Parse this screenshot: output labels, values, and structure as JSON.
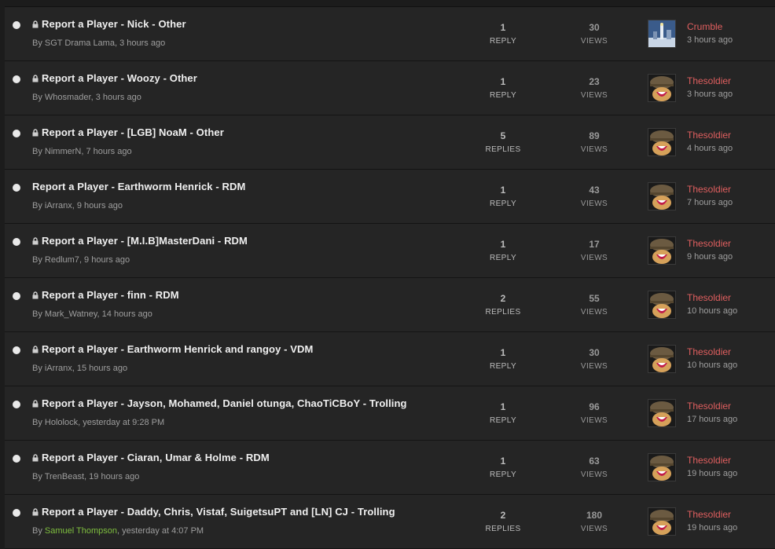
{
  "topics": [
    {
      "title": "Report a Player - Nick - Other",
      "locked": true,
      "by_prefix": "By ",
      "author": "SGT Drama Lama",
      "started": ", 3 hours ago",
      "replies": "1",
      "replies_label": "REPLY",
      "views": "30",
      "views_label": "VIEWS",
      "last_user": "Crumble",
      "last_time": "3 hours ago",
      "avatar": "city-avatar-icon"
    },
    {
      "title": "Report a Player - Woozy - Other",
      "locked": true,
      "by_prefix": "By ",
      "author": "Whosmader",
      "started": ", 3 hours ago",
      "replies": "1",
      "replies_label": "REPLY",
      "views": "23",
      "views_label": "VIEWS",
      "last_user": "Thesoldier",
      "last_time": "3 hours ago",
      "avatar": "soldier-avatar-icon"
    },
    {
      "title": "Report a Player - [LGB] NoaM - Other",
      "locked": true,
      "by_prefix": "By ",
      "author": "NimmerN",
      "started": ", 7 hours ago",
      "replies": "5",
      "replies_label": "REPLIES",
      "views": "89",
      "views_label": "VIEWS",
      "last_user": "Thesoldier",
      "last_time": "4 hours ago",
      "avatar": "soldier-avatar-icon"
    },
    {
      "title": "Report a Player - Earthworm Henrick - RDM",
      "locked": false,
      "by_prefix": "By ",
      "author": "iArranx",
      "started": ", 9 hours ago",
      "replies": "1",
      "replies_label": "REPLY",
      "views": "43",
      "views_label": "VIEWS",
      "last_user": "Thesoldier",
      "last_time": "7 hours ago",
      "avatar": "soldier-avatar-icon"
    },
    {
      "title": "Report a Player - [M.I.B]MasterDani - RDM",
      "locked": true,
      "by_prefix": "By ",
      "author": "Redlum7",
      "started": ", 9 hours ago",
      "replies": "1",
      "replies_label": "REPLY",
      "views": "17",
      "views_label": "VIEWS",
      "last_user": "Thesoldier",
      "last_time": "9 hours ago",
      "avatar": "soldier-avatar-icon"
    },
    {
      "title": "Report a Player - finn - RDM",
      "locked": true,
      "by_prefix": "By ",
      "author": "Mark_Watney",
      "started": ", 14 hours ago",
      "replies": "2",
      "replies_label": "REPLIES",
      "views": "55",
      "views_label": "VIEWS",
      "last_user": "Thesoldier",
      "last_time": "10 hours ago",
      "avatar": "soldier-avatar-icon"
    },
    {
      "title": "Report a Player - Earthworm Henrick and rangoy - VDM",
      "locked": true,
      "by_prefix": "By ",
      "author": "iArranx",
      "started": ", 15 hours ago",
      "replies": "1",
      "replies_label": "REPLY",
      "views": "30",
      "views_label": "VIEWS",
      "last_user": "Thesoldier",
      "last_time": "10 hours ago",
      "avatar": "soldier-avatar-icon"
    },
    {
      "title": "Report a Player - Jayson, Mohamed, Daniel otunga, ChaoTiCBoY - Trolling",
      "locked": true,
      "by_prefix": "By ",
      "author": "Hololock",
      "started": ", yesterday at 9:28 PM",
      "replies": "1",
      "replies_label": "REPLY",
      "views": "96",
      "views_label": "VIEWS",
      "last_user": "Thesoldier",
      "last_time": "17 hours ago",
      "avatar": "soldier-avatar-icon"
    },
    {
      "title": "Report a Player - Ciaran, Umar & Holme - RDM",
      "locked": true,
      "by_prefix": "By ",
      "author": "TrenBeast",
      "started": ", 19 hours ago",
      "replies": "1",
      "replies_label": "REPLY",
      "views": "63",
      "views_label": "VIEWS",
      "last_user": "Thesoldier",
      "last_time": "19 hours ago",
      "avatar": "soldier-avatar-icon"
    },
    {
      "title": "Report a Player - Daddy, Chris, Vistaf, SuigetsuPT and [LN] CJ - Trolling",
      "locked": true,
      "by_prefix": "By ",
      "author": "Samuel Thompson",
      "author_color": "green",
      "started": ", yesterday at 4:07 PM",
      "replies": "2",
      "replies_label": "REPLIES",
      "views": "180",
      "views_label": "VIEWS",
      "last_user": "Thesoldier",
      "last_time": "19 hours ago",
      "avatar": "soldier-avatar-icon"
    }
  ],
  "colors": {
    "background": "#1c1c1c",
    "row": "#252525",
    "title": "#f0f0f0",
    "meta": "#9e9e9e",
    "last_user": "#e05f5f",
    "green_author": "#7fbf3f"
  }
}
